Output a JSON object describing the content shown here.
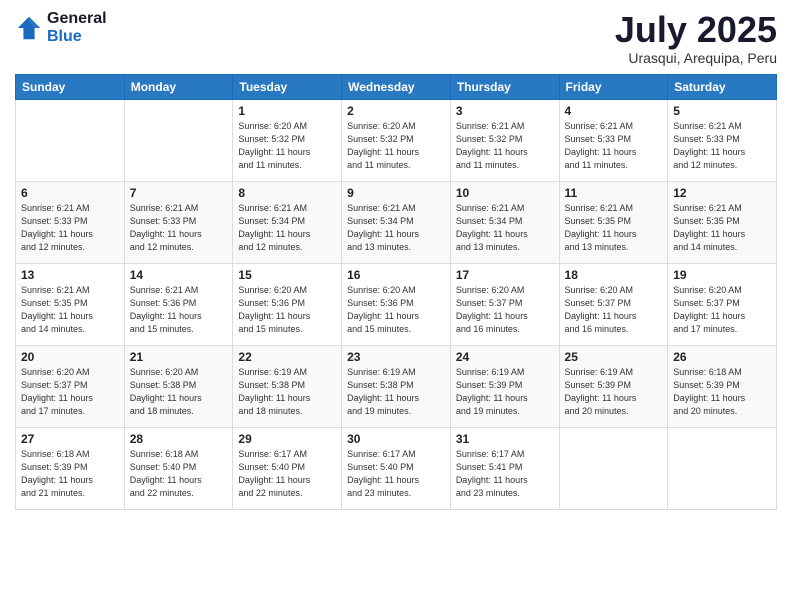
{
  "logo": {
    "general": "General",
    "blue": "Blue"
  },
  "header": {
    "month": "July 2025",
    "location": "Urasqui, Arequipa, Peru"
  },
  "weekdays": [
    "Sunday",
    "Monday",
    "Tuesday",
    "Wednesday",
    "Thursday",
    "Friday",
    "Saturday"
  ],
  "weeks": [
    [
      {
        "day": "",
        "sunrise": "",
        "sunset": "",
        "daylight": ""
      },
      {
        "day": "",
        "sunrise": "",
        "sunset": "",
        "daylight": ""
      },
      {
        "day": "1",
        "sunrise": "Sunrise: 6:20 AM",
        "sunset": "Sunset: 5:32 PM",
        "daylight": "Daylight: 11 hours and 11 minutes."
      },
      {
        "day": "2",
        "sunrise": "Sunrise: 6:20 AM",
        "sunset": "Sunset: 5:32 PM",
        "daylight": "Daylight: 11 hours and 11 minutes."
      },
      {
        "day": "3",
        "sunrise": "Sunrise: 6:21 AM",
        "sunset": "Sunset: 5:32 PM",
        "daylight": "Daylight: 11 hours and 11 minutes."
      },
      {
        "day": "4",
        "sunrise": "Sunrise: 6:21 AM",
        "sunset": "Sunset: 5:33 PM",
        "daylight": "Daylight: 11 hours and 11 minutes."
      },
      {
        "day": "5",
        "sunrise": "Sunrise: 6:21 AM",
        "sunset": "Sunset: 5:33 PM",
        "daylight": "Daylight: 11 hours and 12 minutes."
      }
    ],
    [
      {
        "day": "6",
        "sunrise": "Sunrise: 6:21 AM",
        "sunset": "Sunset: 5:33 PM",
        "daylight": "Daylight: 11 hours and 12 minutes."
      },
      {
        "day": "7",
        "sunrise": "Sunrise: 6:21 AM",
        "sunset": "Sunset: 5:33 PM",
        "daylight": "Daylight: 11 hours and 12 minutes."
      },
      {
        "day": "8",
        "sunrise": "Sunrise: 6:21 AM",
        "sunset": "Sunset: 5:34 PM",
        "daylight": "Daylight: 11 hours and 12 minutes."
      },
      {
        "day": "9",
        "sunrise": "Sunrise: 6:21 AM",
        "sunset": "Sunset: 5:34 PM",
        "daylight": "Daylight: 11 hours and 13 minutes."
      },
      {
        "day": "10",
        "sunrise": "Sunrise: 6:21 AM",
        "sunset": "Sunset: 5:34 PM",
        "daylight": "Daylight: 11 hours and 13 minutes."
      },
      {
        "day": "11",
        "sunrise": "Sunrise: 6:21 AM",
        "sunset": "Sunset: 5:35 PM",
        "daylight": "Daylight: 11 hours and 13 minutes."
      },
      {
        "day": "12",
        "sunrise": "Sunrise: 6:21 AM",
        "sunset": "Sunset: 5:35 PM",
        "daylight": "Daylight: 11 hours and 14 minutes."
      }
    ],
    [
      {
        "day": "13",
        "sunrise": "Sunrise: 6:21 AM",
        "sunset": "Sunset: 5:35 PM",
        "daylight": "Daylight: 11 hours and 14 minutes."
      },
      {
        "day": "14",
        "sunrise": "Sunrise: 6:21 AM",
        "sunset": "Sunset: 5:36 PM",
        "daylight": "Daylight: 11 hours and 15 minutes."
      },
      {
        "day": "15",
        "sunrise": "Sunrise: 6:20 AM",
        "sunset": "Sunset: 5:36 PM",
        "daylight": "Daylight: 11 hours and 15 minutes."
      },
      {
        "day": "16",
        "sunrise": "Sunrise: 6:20 AM",
        "sunset": "Sunset: 5:36 PM",
        "daylight": "Daylight: 11 hours and 15 minutes."
      },
      {
        "day": "17",
        "sunrise": "Sunrise: 6:20 AM",
        "sunset": "Sunset: 5:37 PM",
        "daylight": "Daylight: 11 hours and 16 minutes."
      },
      {
        "day": "18",
        "sunrise": "Sunrise: 6:20 AM",
        "sunset": "Sunset: 5:37 PM",
        "daylight": "Daylight: 11 hours and 16 minutes."
      },
      {
        "day": "19",
        "sunrise": "Sunrise: 6:20 AM",
        "sunset": "Sunset: 5:37 PM",
        "daylight": "Daylight: 11 hours and 17 minutes."
      }
    ],
    [
      {
        "day": "20",
        "sunrise": "Sunrise: 6:20 AM",
        "sunset": "Sunset: 5:37 PM",
        "daylight": "Daylight: 11 hours and 17 minutes."
      },
      {
        "day": "21",
        "sunrise": "Sunrise: 6:20 AM",
        "sunset": "Sunset: 5:38 PM",
        "daylight": "Daylight: 11 hours and 18 minutes."
      },
      {
        "day": "22",
        "sunrise": "Sunrise: 6:19 AM",
        "sunset": "Sunset: 5:38 PM",
        "daylight": "Daylight: 11 hours and 18 minutes."
      },
      {
        "day": "23",
        "sunrise": "Sunrise: 6:19 AM",
        "sunset": "Sunset: 5:38 PM",
        "daylight": "Daylight: 11 hours and 19 minutes."
      },
      {
        "day": "24",
        "sunrise": "Sunrise: 6:19 AM",
        "sunset": "Sunset: 5:39 PM",
        "daylight": "Daylight: 11 hours and 19 minutes."
      },
      {
        "day": "25",
        "sunrise": "Sunrise: 6:19 AM",
        "sunset": "Sunset: 5:39 PM",
        "daylight": "Daylight: 11 hours and 20 minutes."
      },
      {
        "day": "26",
        "sunrise": "Sunrise: 6:18 AM",
        "sunset": "Sunset: 5:39 PM",
        "daylight": "Daylight: 11 hours and 20 minutes."
      }
    ],
    [
      {
        "day": "27",
        "sunrise": "Sunrise: 6:18 AM",
        "sunset": "Sunset: 5:39 PM",
        "daylight": "Daylight: 11 hours and 21 minutes."
      },
      {
        "day": "28",
        "sunrise": "Sunrise: 6:18 AM",
        "sunset": "Sunset: 5:40 PM",
        "daylight": "Daylight: 11 hours and 22 minutes."
      },
      {
        "day": "29",
        "sunrise": "Sunrise: 6:17 AM",
        "sunset": "Sunset: 5:40 PM",
        "daylight": "Daylight: 11 hours and 22 minutes."
      },
      {
        "day": "30",
        "sunrise": "Sunrise: 6:17 AM",
        "sunset": "Sunset: 5:40 PM",
        "daylight": "Daylight: 11 hours and 23 minutes."
      },
      {
        "day": "31",
        "sunrise": "Sunrise: 6:17 AM",
        "sunset": "Sunset: 5:41 PM",
        "daylight": "Daylight: 11 hours and 23 minutes."
      },
      {
        "day": "",
        "sunrise": "",
        "sunset": "",
        "daylight": ""
      },
      {
        "day": "",
        "sunrise": "",
        "sunset": "",
        "daylight": ""
      }
    ]
  ]
}
